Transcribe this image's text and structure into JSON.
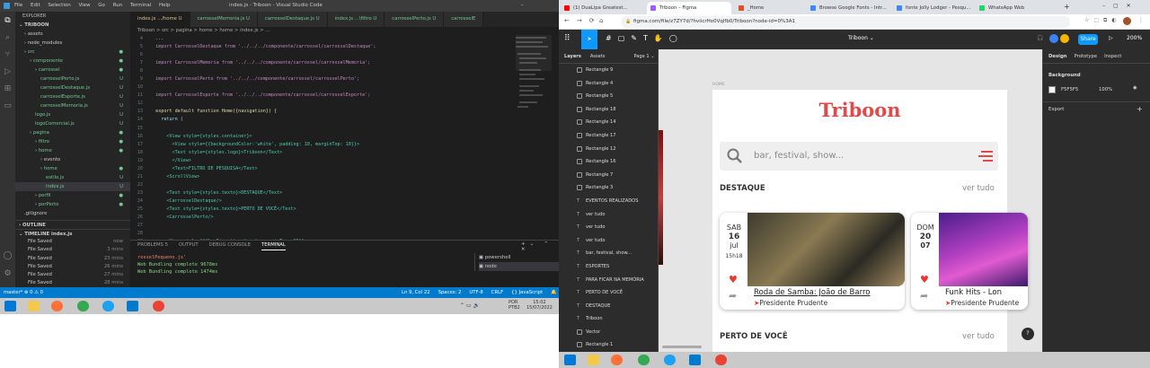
{
  "vscode": {
    "menu": [
      "File",
      "Edit",
      "Selection",
      "View",
      "Go",
      "Run",
      "Terminal",
      "Help"
    ],
    "title": "index.js - Triboon - Visual Studio Code",
    "tabs": [
      {
        "label": "index.js .../home U",
        "active": true
      },
      {
        "label": "carrosselMemoria.js U",
        "active": false
      },
      {
        "label": "carrosselDestaque.js U",
        "active": false
      },
      {
        "label": "index.js ...\\filtro U",
        "active": false
      },
      {
        "label": "carrosselPerto.js U",
        "active": false
      },
      {
        "label": "carrosselE",
        "active": false
      }
    ],
    "breadcrumb": "Triboon > src > pagina > home > home > index.js > ...",
    "explorer_title": "EXPLORER",
    "project": "TRIBOON",
    "files": [
      {
        "label": "assets",
        "indent": 1,
        "mark": ""
      },
      {
        "label": "node_modules",
        "indent": 1,
        "mark": ""
      },
      {
        "label": "src",
        "indent": 1,
        "mark": "●"
      },
      {
        "label": "componente",
        "indent": 2,
        "mark": "●"
      },
      {
        "label": "carrossel",
        "indent": 3,
        "mark": "●"
      },
      {
        "label": "carrosselPerto.js",
        "indent": 4,
        "mark": "U"
      },
      {
        "label": "carrosselDestaque.js",
        "indent": 4,
        "mark": "U"
      },
      {
        "label": "carrosselEsporte.js",
        "indent": 4,
        "mark": "U"
      },
      {
        "label": "carrosselMemoria.js",
        "indent": 4,
        "mark": "U"
      },
      {
        "label": "logo.js",
        "indent": 3,
        "mark": "U"
      },
      {
        "label": "logoComercial.js",
        "indent": 3,
        "mark": "U"
      },
      {
        "label": "pagina",
        "indent": 2,
        "mark": "●"
      },
      {
        "label": "filtro",
        "indent": 3,
        "mark": "●"
      },
      {
        "label": "home",
        "indent": 3,
        "mark": "●"
      },
      {
        "label": "evento",
        "indent": 4,
        "mark": ""
      },
      {
        "label": "home",
        "indent": 4,
        "mark": "●"
      },
      {
        "label": "estilo.js",
        "indent": 5,
        "mark": "U"
      },
      {
        "label": "index.js",
        "indent": 5,
        "mark": "U"
      },
      {
        "label": "perfil",
        "indent": 3,
        "mark": "●"
      },
      {
        "label": "porPerto",
        "indent": 3,
        "mark": "●"
      },
      {
        "label": ".gitignore",
        "indent": 1,
        "mark": ""
      }
    ],
    "outline": "OUTLINE",
    "timeline": "TIMELINE  index.js",
    "timeline_items": [
      {
        "label": "File Saved",
        "time": "now"
      },
      {
        "label": "File Saved",
        "time": "3 mins"
      },
      {
        "label": "File Saved",
        "time": "23 mins"
      },
      {
        "label": "File Saved",
        "time": "26 mins"
      },
      {
        "label": "File Saved",
        "time": "27 mins"
      },
      {
        "label": "File Saved",
        "time": "28 mins"
      }
    ],
    "code_lines": [
      {
        "n": "4",
        "t": "  ...  "
      },
      {
        "n": "5",
        "t": "  import CarrosselDestaque from '../../../componente/carrossel/carrosselDestaque';"
      },
      {
        "n": "6",
        "t": ""
      },
      {
        "n": "7",
        "t": "  import CarrosselMemoria from '../../../componente/carrossel/carrosselMemoria';"
      },
      {
        "n": "8",
        "t": ""
      },
      {
        "n": "9",
        "t": "  import CarrosselPerto from '../../../componente/carrossel/carrosselPerto';"
      },
      {
        "n": "10",
        "t": ""
      },
      {
        "n": "11",
        "t": "  import CarrosselEsporte from '../../../componente/carrossel/carrosselEsporte';"
      },
      {
        "n": "12",
        "t": ""
      },
      {
        "n": "13",
        "t": "  export default function Home({navigation}) {"
      },
      {
        "n": "14",
        "t": "    return ("
      },
      {
        "n": "15",
        "t": ""
      },
      {
        "n": "16",
        "t": "      <View style={styles.container}>"
      },
      {
        "n": "17",
        "t": "        <View style={{backgroundColor:'white', padding: 10, marginTop: 10}}>"
      },
      {
        "n": "18",
        "t": "        <Text style={styles.logo}>Triboon</Text>"
      },
      {
        "n": "19",
        "t": "        </View>"
      },
      {
        "n": "20",
        "t": "        <Text>FILTRO DE PESQUISA</Text>"
      },
      {
        "n": "21",
        "t": "      <ScrollView>"
      },
      {
        "n": "22",
        "t": ""
      },
      {
        "n": "23",
        "t": "      <Text style={styles.texto}>DESTAQUE</Text>"
      },
      {
        "n": "24",
        "t": "      <CarrosselDestaque/>"
      },
      {
        "n": "25",
        "t": "      <Text style={styles.texto}>PERTO DE VOCÊ</Text>"
      },
      {
        "n": "26",
        "t": "      <CarrosselPerto/>"
      },
      {
        "n": "27",
        "t": ""
      },
      {
        "n": "28",
        "t": ""
      },
      {
        "n": "29",
        "t": "      <View style={{flexDirection:'row', marginTop: 15}}>"
      }
    ],
    "panel_tabs": [
      "PROBLEMS  5",
      "OUTPUT",
      "DEBUG CONSOLE",
      "TERMINAL"
    ],
    "terminal_lines": [
      "rosselPequeno.js'",
      "Web Bundling complete 9678ms",
      "Web Bundling complete 1474ms"
    ],
    "terminals": [
      "powershell",
      "node"
    ],
    "status_left": "master*  ⊗ 0 ⚠ 0",
    "status_right": [
      "Ln 9, Col 22",
      "Spaces: 2",
      "UTF-8",
      "CRLF",
      "{} JavaScript"
    ]
  },
  "chrome": {
    "tabs": [
      {
        "label": "(1) DuaLipa Greatest...",
        "color": "#ff0000"
      },
      {
        "label": "Triboon – Figma",
        "color": "#a259ff",
        "active": true
      },
      {
        "label": "_Home",
        "color": "#e44d26"
      },
      {
        "label": "Browse Google Fonts - Intr...",
        "color": "#4285f4"
      },
      {
        "label": "fonte Jolly Lodger - Pesqu...",
        "color": "#4285f4"
      },
      {
        "label": "WhatsApp Web",
        "color": "#25d366"
      }
    ],
    "url": "figma.com/file/z7ZY7d/?hviicrHo0Vqlfb0/Triboon?node-id=0%3A1"
  },
  "figma": {
    "file_name": "Triboon ⌄",
    "share": "Share",
    "zoom": "200%",
    "left_tabs": [
      "Layers",
      "Assets",
      "Page 1 ⌄"
    ],
    "layers": [
      "Rectangle 9",
      "Rectangle 4",
      "Rectangle 5",
      "Rectangle 18",
      "Rectangle 14",
      "Rectangle 17",
      "Rectangle 12",
      "Rectangle 16",
      "Rectangle 7",
      "Rectangle 3",
      "EVENTOS REALIZADOS",
      "ver tudo",
      "ver tudo",
      "ver tudo",
      "bar, festival, show...",
      "ESPORTES",
      "PARA FICAR NA MEMÓRIA",
      "PERTO DE VOCÊ",
      "DESTAQUE",
      "Triboon",
      "Vector",
      "Rectangle 1"
    ],
    "right_tabs": [
      "Design",
      "Prototype",
      "Inspect"
    ],
    "background_label": "Background",
    "background_hex": "F5F5F5",
    "background_opacity": "100%",
    "export_label": "Export",
    "frame_label": "HOME",
    "app": {
      "logo": "Triboon",
      "search_placeholder": "bar, festival, show...",
      "destaque": "DESTAQUE",
      "ver_tudo": "ver tudo",
      "perto": "PERTO DE VOCÊ",
      "ver_tudo_2": "ver tudo",
      "cards": [
        {
          "weekday": "SAB",
          "day": "16",
          "month": "jul",
          "time": "15h18",
          "title": "Roda de Samba: João de Barro",
          "location": "Presidente Prudente"
        },
        {
          "weekday": "DOM",
          "day": "20",
          "month": "07",
          "time": "",
          "title": "Funk Hits - Lon",
          "location": "Presidente Prudente"
        }
      ]
    }
  },
  "taskbar": {
    "lang": "POR PTB2",
    "time": "15:02",
    "date": "15/07/2022"
  }
}
